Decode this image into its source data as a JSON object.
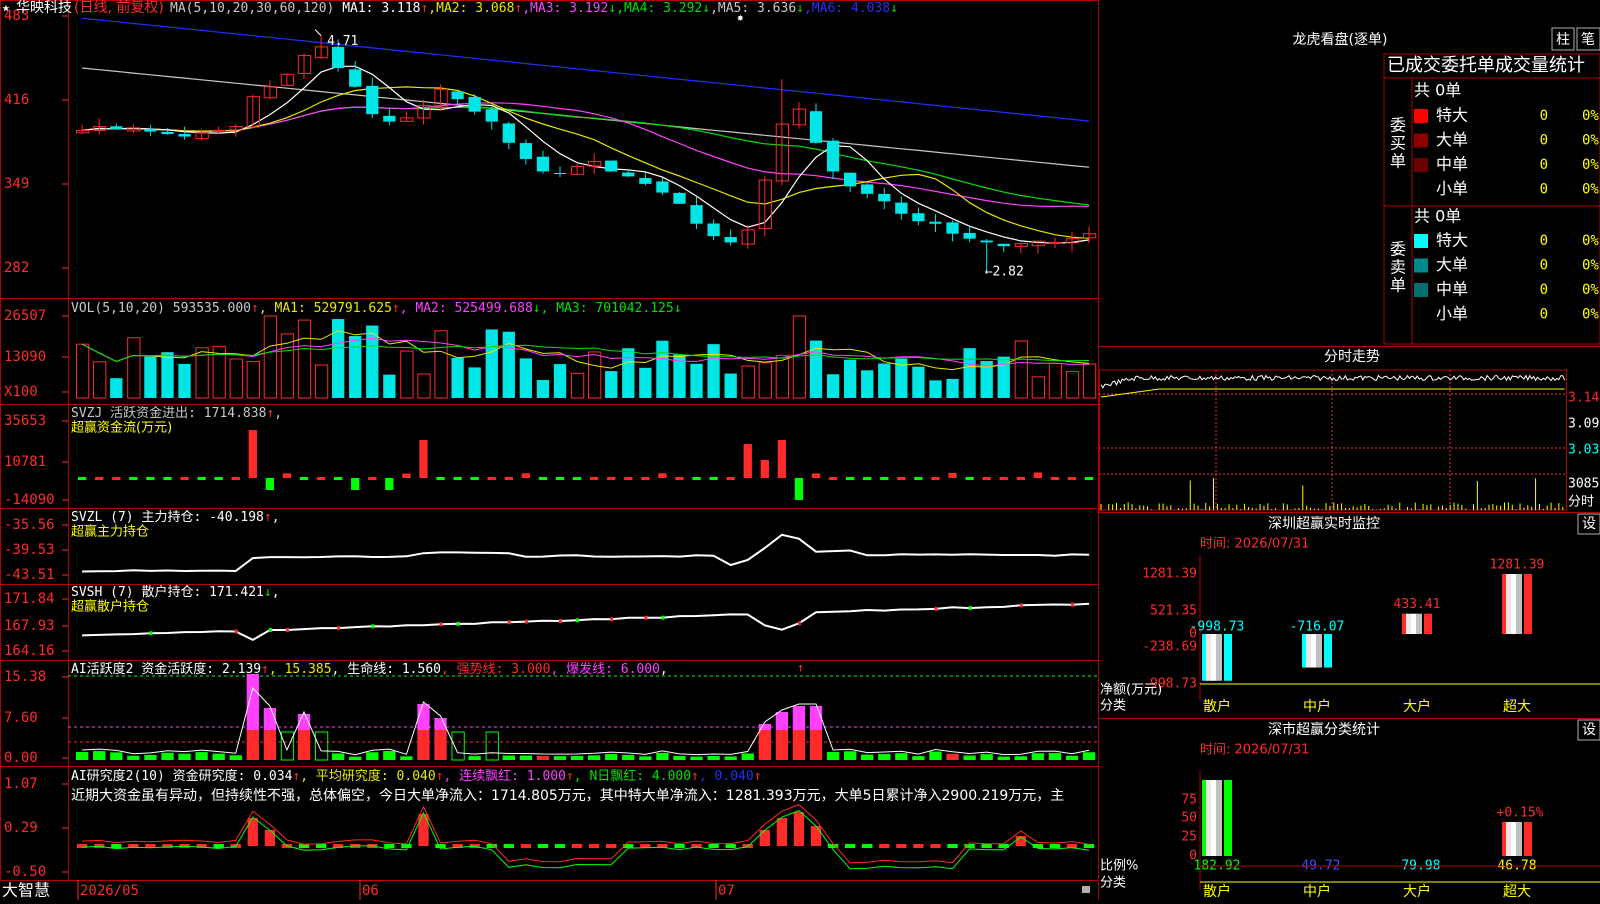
{
  "stock": {
    "name": "华映科技",
    "mode": "(日线, 前复权)",
    "star": "★"
  },
  "colors": {
    "up": "#ff2a2a",
    "down": "#00e6e6",
    "frame": "#b00000",
    "ma1": "#ffffff",
    "ma2": "#e8e800",
    "ma3": "#ff40ff",
    "ma4": "#00e000",
    "ma5": "#c8c8c8",
    "ma6": "#2030ff",
    "green": "#00ff00",
    "yellow": "#ffff00",
    "magenta": "#ff40ff",
    "cyan": "#00ffff"
  },
  "price_panel": {
    "header": [
      {
        "text": "MA(5,10,20,30,60,120)",
        "color": "#c8c8c8"
      },
      {
        "text": " MA1: 3.118",
        "color": "#ffffff"
      },
      {
        "text": "↑",
        "color": "#ff2a2a"
      },
      {
        "text": ",MA2: 3.068",
        "color": "#e8e800"
      },
      {
        "text": "↑",
        "color": "#ff2a2a"
      },
      {
        "text": ",MA3: 3.192",
        "color": "#ff40ff"
      },
      {
        "text": "↓",
        "color": "#00e000"
      },
      {
        "text": ",MA4: 3.292",
        "color": "#00e000"
      },
      {
        "text": "↓",
        "color": "#00e000"
      },
      {
        "text": ",MA5: 3.636",
        "color": "#c8c8c8"
      },
      {
        "text": "↓",
        "color": "#00e000"
      },
      {
        "text": ",MA6: 4.038",
        "color": "#2030ff"
      },
      {
        "text": "↓",
        "color": "#00e000"
      }
    ],
    "yticks": [
      "483",
      "416",
      "349",
      "282"
    ],
    "high_label": "4.71",
    "low_label": "←2.82"
  },
  "vol_panel": {
    "header": [
      {
        "text": "VOL(5,10,20) 593535.000",
        "color": "#c8c8c8"
      },
      {
        "text": "↑",
        "color": "#ff2a2a"
      },
      {
        "text": ", MA1: 529791.625",
        "color": "#e8e800"
      },
      {
        "text": "↑",
        "color": "#ff2a2a"
      },
      {
        "text": ", MA2: 525499.688",
        "color": "#ff40ff"
      },
      {
        "text": "↓",
        "color": "#00e000"
      },
      {
        "text": ", MA3: 701042.125",
        "color": "#00e000"
      },
      {
        "text": "↓",
        "color": "#00e000"
      }
    ],
    "yticks": [
      "26507",
      "13090",
      "X100"
    ]
  },
  "svzj_panel": {
    "line1": [
      {
        "text": "SVZJ  活跃资金进出: 1714.838",
        "color": "#c8c8c8"
      },
      {
        "text": "↑",
        "color": "#ff2a2a"
      },
      {
        "text": ",",
        "color": "#c8c8c8"
      }
    ],
    "line2": "超赢资金流(万元)",
    "yticks": [
      "35653",
      "10781",
      "-14090"
    ]
  },
  "svzl_panel": {
    "line1": [
      {
        "text": "SVZL (7) 主力持仓: -40.198",
        "color": "#ffffff"
      },
      {
        "text": "↑",
        "color": "#ff2a2a"
      },
      {
        "text": ",",
        "color": "#ffffff"
      }
    ],
    "line2": "超赢主力持仓",
    "yticks": [
      "-35.56",
      "-39.53",
      "-43.51"
    ]
  },
  "svsh_panel": {
    "line1": [
      {
        "text": "SVSH (7) 散户持仓: 171.421",
        "color": "#ffffff"
      },
      {
        "text": "↓",
        "color": "#00e000"
      },
      {
        "text": ",",
        "color": "#ffffff"
      }
    ],
    "line2": "超赢散户持仓",
    "yticks": [
      "171.84",
      "167.93",
      "164.16"
    ]
  },
  "ai1_panel": {
    "header": [
      {
        "text": "AI活跃度2 资金活跃度: 2.139",
        "color": "#ffffff"
      },
      {
        "text": "↑",
        "color": "#ff2a2a"
      },
      {
        "text": ", 15.385",
        "color": "#e8e800"
      },
      {
        "text": ", 生命线: 1.560",
        "color": "#ffffff"
      },
      {
        "text": ", 强势线: 3.000",
        "color": "#ff2a2a"
      },
      {
        "text": ", 爆发线: 6.000",
        "color": "#ff40ff"
      },
      {
        "text": ",",
        "color": "#ffffff"
      }
    ],
    "yticks": [
      "15.38",
      "7.60",
      "0.00"
    ]
  },
  "ai2_panel": {
    "header": [
      {
        "text": "AI研究度2(10) 资金研究度: 0.034",
        "color": "#ffffff"
      },
      {
        "text": "↑",
        "color": "#ff2a2a"
      },
      {
        "text": ", 平均研究度: 0.040",
        "color": "#e8e800"
      },
      {
        "text": "↑",
        "color": "#ff2a2a"
      },
      {
        "text": ", 连续飘红: 1.000",
        "color": "#ff40ff"
      },
      {
        "text": "↑",
        "color": "#ff2a2a"
      },
      {
        "text": ", N日飘红: 4.000",
        "color": "#00e000"
      },
      {
        "text": "↑",
        "color": "#ff2a2a"
      },
      {
        "text": ", 0.040",
        "color": "#2030ff"
      },
      {
        "text": "↑",
        "color": "#ff2a2a"
      }
    ],
    "comment": "近期大资金虽有异动，但持续性不强，总体偏空，今日大单净流入：1714.805万元，其中特大单净流入：1281.393万元，大单5日累计净入2900.219万元，主",
    "yticks": [
      "1.07",
      "0.29",
      "-0.50"
    ]
  },
  "bottom_bar": {
    "brand": "大智慧",
    "dates": [
      "2026/05",
      "06",
      "07"
    ]
  },
  "dragon": {
    "title": "龙虎看盘(逐单)",
    "btn_zhu": "柱",
    "btn_bi": "笔",
    "stats_title": "已成交委托单成交量统计",
    "buy_label": "委买单",
    "sell_label": "委卖单",
    "buy_total": "共 0单",
    "sell_total": "共 0单",
    "buy_rows": [
      {
        "name": "特大",
        "count": "0",
        "pct": "0%",
        "color": "#ff0000"
      },
      {
        "name": "大单",
        "count": "0",
        "pct": "0%",
        "color": "#8b0000"
      },
      {
        "name": "中单",
        "count": "0",
        "pct": "0%",
        "color": "#6a0000"
      },
      {
        "name": "小单",
        "count": "0",
        "pct": "0%",
        "color": ""
      }
    ],
    "sell_rows": [
      {
        "name": "特大",
        "count": "0",
        "pct": "0%",
        "color": "#00ffff"
      },
      {
        "name": "大单",
        "count": "0",
        "pct": "0%",
        "color": "#008b8b"
      },
      {
        "name": "中单",
        "count": "0",
        "pct": "0%",
        "color": "#007070"
      },
      {
        "name": "小单",
        "count": "0",
        "pct": "0%",
        "color": ""
      }
    ]
  },
  "intraday": {
    "title": "分时走势",
    "yticks": [
      "3.145",
      "3.090",
      "3.035",
      "30858",
      "分时"
    ]
  },
  "shenzhen_monitor": {
    "title": "深圳超赢实时监控",
    "set": "设",
    "time": "时间: 2026/07/31",
    "yticks": [
      "1281.39",
      "521.35",
      "0",
      "-238.69",
      "-998.73"
    ],
    "unit": "净额(万元)",
    "axis": "分类",
    "bars": [
      {
        "cat": "散户",
        "value": -998.73,
        "label": "-998.73"
      },
      {
        "cat": "中户",
        "value": -716.07,
        "label": "-716.07"
      },
      {
        "cat": "大户",
        "value": 433.41,
        "label": "433.41"
      },
      {
        "cat": "超大",
        "value": 1281.39,
        "label": "1281.39"
      }
    ]
  },
  "shenzhen_class": {
    "title": "深市超赢分类统计",
    "set": "设",
    "time": "时间: 2026/07/31",
    "yticks": [
      "75",
      "50",
      "25",
      "0"
    ],
    "unit": "比例%",
    "axis": "分类",
    "cats": [
      "散户",
      "中户",
      "大户",
      "超大"
    ],
    "values": [
      "182.92",
      "-49.72",
      "-79.98",
      "46.78"
    ],
    "extra_label": "+0.15%"
  }
}
